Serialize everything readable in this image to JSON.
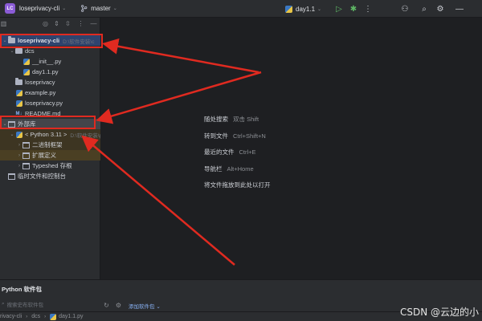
{
  "topbar": {
    "project_badge": "LC",
    "project_name": "loseprivacy-cli",
    "branch": "master",
    "run_config": "day1.1"
  },
  "project_panel": {
    "tree": [
      {
        "label": "loseprivacy-cli",
        "sub": "D:\\软件安装\\c",
        "icon": "folder-icon",
        "arrow": "⌄",
        "indent": 0
      },
      {
        "label": "dcs",
        "sub": "",
        "icon": "folder-icon",
        "arrow": "⌄",
        "indent": 1
      },
      {
        "label": "__init__.py",
        "sub": "",
        "icon": "python-file-icon",
        "arrow": "",
        "indent": 2
      },
      {
        "label": "day1.1.py",
        "sub": "",
        "icon": "python-file-icon",
        "arrow": "",
        "indent": 2
      },
      {
        "label": "loseprivacy",
        "sub": "",
        "icon": "folder-icon",
        "arrow": "",
        "indent": 1
      },
      {
        "label": "example.py",
        "sub": "",
        "icon": "python-file-icon",
        "arrow": "",
        "indent": 1
      },
      {
        "label": "loseprivacy.py",
        "sub": "",
        "icon": "python-file-icon",
        "arrow": "",
        "indent": 1
      },
      {
        "label": "README.md",
        "sub": "",
        "icon": "markdown-file-icon",
        "arrow": "",
        "indent": 1
      },
      {
        "label": "外部库",
        "sub": "",
        "icon": "library-icon",
        "arrow": "⌄",
        "indent": 0
      },
      {
        "label": "< Python 3.11 >",
        "sub": "D:\\软件安装\\p",
        "icon": "python-file-icon",
        "arrow": "⌄",
        "indent": 1
      },
      {
        "label": "二进制框架",
        "sub": "",
        "icon": "library-icon",
        "arrow": "›",
        "indent": 2
      },
      {
        "label": "扩展定义",
        "sub": "",
        "icon": "library-icon",
        "arrow": "›",
        "indent": 2
      },
      {
        "label": "Typeshed 存根",
        "sub": "",
        "icon": "library-icon",
        "arrow": "›",
        "indent": 2
      },
      {
        "label": "临时文件和控制台",
        "sub": "",
        "icon": "console-icon",
        "arrow": "",
        "indent": 0
      }
    ]
  },
  "editor_tips": [
    {
      "label": "随处搜索",
      "shortcut": "双击 Shift"
    },
    {
      "label": "转到文件",
      "shortcut": "Ctrl+Shift+N"
    },
    {
      "label": "最近的文件",
      "shortcut": "Ctrl+E"
    },
    {
      "label": "导航栏",
      "shortcut": "Alt+Home"
    },
    {
      "label": "将文件拖放到此处以打开",
      "shortcut": ""
    }
  ],
  "bottom_panel": {
    "title": "Python 软件包",
    "search_placeholder": "搜索史布软件包",
    "add_package": "添加软件包"
  },
  "statusbar": {
    "crumbs": [
      "rivacy-cli",
      "dcs",
      "day1.1.py"
    ]
  },
  "watermark": "CSDN @云边的小"
}
